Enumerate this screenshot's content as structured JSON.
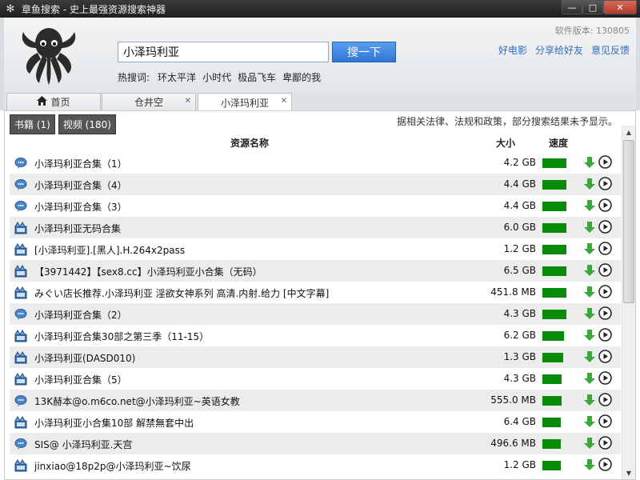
{
  "window": {
    "title": "章鱼搜索 - 史上最强资源搜索神器",
    "min": "—",
    "max": "□",
    "close": "✕"
  },
  "header": {
    "version": "软件版本: 130805",
    "search_value": "小泽玛利亚",
    "search_button": "搜一下",
    "hot_label": "热搜词:",
    "hot_words": [
      "环太平洋",
      "小时代",
      "极品飞车",
      "卑鄙的我"
    ],
    "links": [
      "好电影",
      "分享给好友",
      "意见反馈"
    ]
  },
  "tabs": [
    {
      "label": "首页"
    },
    {
      "label": "仓井空"
    },
    {
      "label": "小泽玛利亚"
    }
  ],
  "filters": [
    "书籍 (1)",
    "视频 (180)"
  ],
  "notice": "据相关法律、法规和政策，部分搜索结果未予显示。",
  "table": {
    "headers": {
      "name": "资源名称",
      "size": "大小",
      "speed": "速度"
    },
    "rows": [
      {
        "type": "chat",
        "name": "小泽玛利亚合集（1）",
        "size": "4.2 GB",
        "speed": 1.0
      },
      {
        "type": "chat",
        "name": "小泽玛利亚合集（4）",
        "size": "4.4 GB",
        "speed": 1.0
      },
      {
        "type": "chat",
        "name": "小泽玛利亚合集（3）",
        "size": "4.4 GB",
        "speed": 1.0
      },
      {
        "type": "video",
        "name": "小泽玛利亚无码合集",
        "size": "6.0 GB",
        "speed": 1.0
      },
      {
        "type": "video",
        "name": "[小泽玛利亚].[黑人].H.264x2pass",
        "size": "1.2 GB",
        "speed": 1.0
      },
      {
        "type": "video",
        "name": "【3971442】【sex8.cc】小泽玛利亚小合集（无码）",
        "size": "6.5 GB",
        "speed": 1.0
      },
      {
        "type": "video",
        "name": "みぐい店长推荐.小泽玛利亚 淫欲女神系列 高清.内射.给力 [中文字幕]",
        "size": "451.8 MB",
        "speed": 1.0
      },
      {
        "type": "chat",
        "name": "小泽玛利亚合集（2）",
        "size": "4.3 GB",
        "speed": 1.0
      },
      {
        "type": "video",
        "name": "小泽玛利亚合集30部之第三季（11-15）",
        "size": "6.2 GB",
        "speed": 0.9
      },
      {
        "type": "video",
        "name": "小泽玛利亚(DASD010)",
        "size": "1.3 GB",
        "speed": 0.85
      },
      {
        "type": "video",
        "name": "小泽玛利亚合集（5）",
        "size": "4.3 GB",
        "speed": 0.8
      },
      {
        "type": "chat",
        "name": "13K赫本@o.m6co.net@小泽玛利亚~英语女教",
        "size": "555.0 MB",
        "speed": 0.8
      },
      {
        "type": "video",
        "name": "小泽玛利亚小合集10部 解禁無套中出",
        "size": "6.4 GB",
        "speed": 0.75
      },
      {
        "type": "chat",
        "name": "SIS@ 小泽玛利亚.天宫",
        "size": "496.6 MB",
        "speed": 0.75
      },
      {
        "type": "video",
        "name": "jinxiao@18p2p@小泽玛利亚~饮尿",
        "size": "1.2 GB",
        "speed": 0.75
      }
    ]
  },
  "colors": {
    "accent": "#2f77d8",
    "speed_bar": "#0a8a0a",
    "link": "#2f6fc0"
  }
}
